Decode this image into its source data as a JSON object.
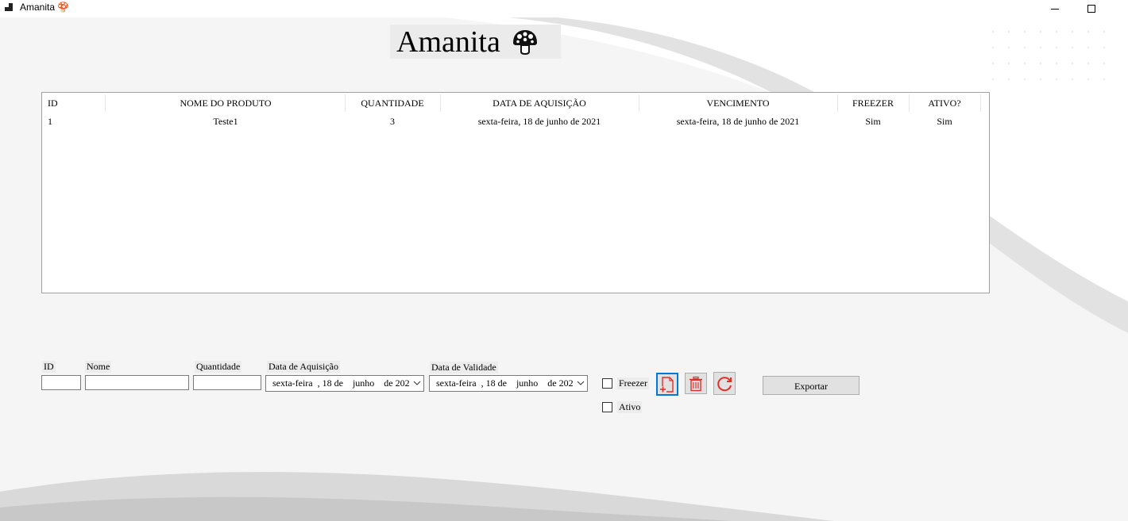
{
  "window": {
    "title": "Amanita 🍄",
    "icons": [
      "app-icon",
      "minimize-icon",
      "maximize-icon"
    ]
  },
  "heading": {
    "text": "Amanita",
    "icon": "mushroom-icon"
  },
  "table": {
    "columns": [
      "ID",
      "NOME DO PRODUTO",
      "QUANTIDADE",
      "DATA DE AQUISIÇÃO",
      "VENCIMENTO",
      "FREEZER",
      "ATIVO?"
    ],
    "rows": [
      [
        "1",
        "Teste1",
        "3",
        "sexta-feira, 18 de junho de 2021",
        "sexta-feira, 18 de junho de 2021",
        "Sim",
        "Sim"
      ]
    ]
  },
  "form": {
    "id_label": "ID",
    "id_value": "",
    "nome_label": "Nome",
    "nome_value": "",
    "quantidade_label": "Quantidade",
    "quantidade_value": "",
    "aquisicao_label": "Data de Aquisição",
    "aquisicao_value": "sexta-feira  , 18 de    junho    de 202",
    "validade_label": "Data de Validade",
    "validade_value": "sexta-feira  , 18 de    junho    de 202",
    "freezer_label": "Freezer",
    "freezer_checked": false,
    "ativo_label": "Ativo",
    "ativo_checked": false
  },
  "actions": {
    "add_icon": "add-document-icon",
    "delete_icon": "trash-icon",
    "refresh_icon": "refresh-icon",
    "export_label": "Exportar"
  },
  "colors": {
    "accent": "#0078d7",
    "icon_red": "#e0302a"
  }
}
